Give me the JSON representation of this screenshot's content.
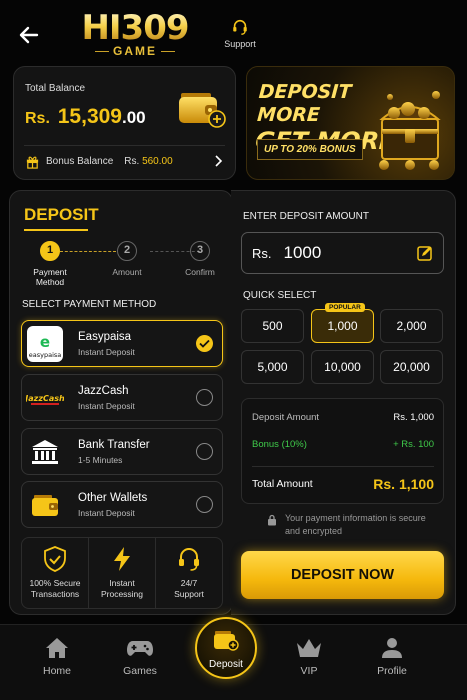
{
  "header": {
    "logo_main": "HI309",
    "logo_sub": "GAME",
    "support_label": "Support"
  },
  "balance": {
    "label": "Total Balance",
    "currency": "Rs.",
    "amount_int": "15,309",
    "amount_dec": ".00",
    "bonus_label": "Bonus Balance",
    "bonus_currency": "Rs.",
    "bonus_value": "560.00"
  },
  "promo": {
    "line1": "DEPOSIT MORE",
    "line2": "GET MORE",
    "badge": "UP TO 20% BONUS"
  },
  "deposit": {
    "title": "DEPOSIT",
    "steps": [
      {
        "num": "1",
        "label": "Payment Method"
      },
      {
        "num": "2",
        "label": "Amount"
      },
      {
        "num": "3",
        "label": "Confirm"
      }
    ],
    "select_label": "SELECT PAYMENT METHOD",
    "methods": [
      {
        "name": "Easypaisa",
        "sub": "Instant Deposit"
      },
      {
        "name": "JazzCash",
        "sub": "Instant Deposit"
      },
      {
        "name": "Bank Transfer",
        "sub": "1-5 Minutes"
      },
      {
        "name": "Other Wallets",
        "sub": "Instant Deposit"
      }
    ],
    "easypaisa_logo_text": "easypaisa",
    "jazzcash_logo_text": "JazzCash",
    "features": [
      {
        "line1": "100% Secure",
        "line2": "Transactions"
      },
      {
        "line1": "Instant",
        "line2": "Processing"
      },
      {
        "line1": "24/7",
        "line2": "Support"
      }
    ]
  },
  "amount": {
    "enter_label": "ENTER DEPOSIT AMOUNT",
    "currency": "Rs.",
    "value": "1000",
    "quick_label": "QUICK SELECT",
    "quick": [
      "500",
      "1,000",
      "2,000",
      "5,000",
      "10,000",
      "20,000"
    ],
    "popular_label": "POPULAR",
    "summary": {
      "deposit_label": "Deposit Amount",
      "deposit_value": "Rs. 1,000",
      "bonus_label": "Bonus (10%)",
      "bonus_value": "+ Rs. 100",
      "total_label": "Total Amount",
      "total_value": "Rs. 1,100"
    },
    "secure_text": "Your payment information is secure and encrypted",
    "button_label": "DEPOSIT NOW"
  },
  "nav": {
    "items": [
      {
        "label": "Home"
      },
      {
        "label": "Games"
      },
      {
        "label": "Deposit"
      },
      {
        "label": "VIP"
      },
      {
        "label": "Profile"
      }
    ]
  },
  "colors": {
    "accent": "#f5c518",
    "background": "#050505",
    "panel": "#141414",
    "bonus_green": "#3fca4a"
  }
}
